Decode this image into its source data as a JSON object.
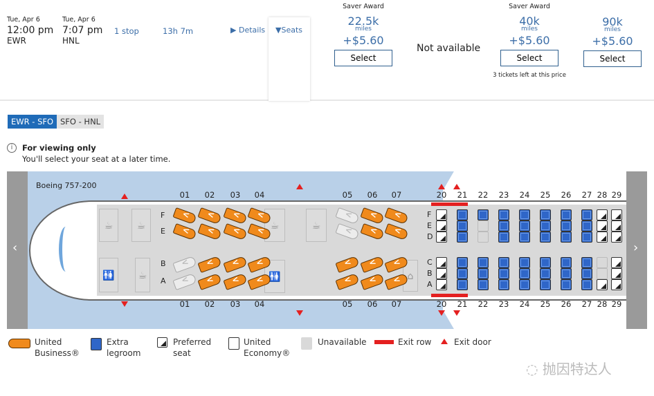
{
  "flight": {
    "depart_date": "Tue, Apr 6",
    "depart_time": "12:00 pm",
    "depart_airport": "EWR",
    "arrive_date": "Tue, Apr 6",
    "arrive_time": "7:07 pm",
    "arrive_airport": "HNL",
    "stops": "1 stop",
    "duration": "13h 7m",
    "details_label": "Details",
    "seats_label": "Seats"
  },
  "fares": [
    {
      "header": "Saver Award",
      "miles": "22.5k",
      "miles_unit": "miles",
      "tax": "+$5.60",
      "button": "Select",
      "note": ""
    },
    {
      "header": "",
      "status": "Not available"
    },
    {
      "header": "Saver Award",
      "miles": "40k",
      "miles_unit": "miles",
      "tax": "+$5.60",
      "button": "Select",
      "note": "3 tickets left at this price"
    },
    {
      "header": "",
      "miles": "90k",
      "miles_unit": "miles",
      "tax": "+$5.60",
      "button": "Select",
      "note": ""
    }
  ],
  "segments": [
    {
      "label": "EWR - SFO",
      "active": true
    },
    {
      "label": "SFO - HNL",
      "active": false
    }
  ],
  "notice": {
    "title": "For viewing only",
    "text": "You'll select your seat at a later time."
  },
  "aircraft": "Boeing 757-200",
  "business": {
    "rows": [
      "01",
      "02",
      "03",
      "04",
      "05",
      "06",
      "07"
    ],
    "letters": [
      "F",
      "E",
      "B",
      "A"
    ],
    "occupied": [
      "01B",
      "01A",
      "05F",
      "05E"
    ]
  },
  "economy": {
    "letters": [
      "F",
      "E",
      "D",
      "C",
      "B",
      "A"
    ],
    "rows": [
      {
        "row": "20",
        "seats": [
          "preferred",
          "preferred",
          "preferred",
          "preferred",
          "preferred",
          "preferred"
        ]
      },
      {
        "row": "21",
        "seats": [
          "extra",
          "extra",
          "extra",
          "extra",
          "extra",
          "extra"
        ]
      },
      {
        "row": "22",
        "seats": [
          "extra",
          "unavailable",
          "unavailable",
          "extra",
          "extra",
          "extra"
        ]
      },
      {
        "row": "23",
        "seats": [
          "extra",
          "extra",
          "extra",
          "extra",
          "extra",
          "extra"
        ]
      },
      {
        "row": "24",
        "seats": [
          "extra",
          "extra",
          "extra",
          "extra",
          "extra",
          "extra"
        ]
      },
      {
        "row": "25",
        "seats": [
          "extra",
          "extra",
          "extra",
          "extra",
          "extra",
          "extra"
        ]
      },
      {
        "row": "26",
        "seats": [
          "extra",
          "extra",
          "extra",
          "extra",
          "extra",
          "extra"
        ]
      },
      {
        "row": "27",
        "seats": [
          "extra",
          "extra",
          "extra",
          "extra",
          "extra",
          "extra"
        ]
      },
      {
        "row": "28",
        "seats": [
          "preferred",
          "preferred",
          "preferred",
          "unavailable",
          "unavailable",
          "preferred"
        ]
      },
      {
        "row": "29",
        "seats": [
          "preferred",
          "preferred",
          "preferred",
          "preferred",
          "preferred",
          "preferred"
        ]
      }
    ]
  },
  "legend": {
    "business": "United Business®",
    "extra": "Extra legroom",
    "preferred": "Preferred seat",
    "economy": "United Economy®",
    "unavailable": "Unavailable",
    "exit_row": "Exit row",
    "exit_door": "Exit door"
  },
  "watermark": "抛因特达人",
  "colors": {
    "accent": "#1f6bb8",
    "extra": "#2f66c8",
    "business": "#f08a1c",
    "exit": "#e42020"
  }
}
